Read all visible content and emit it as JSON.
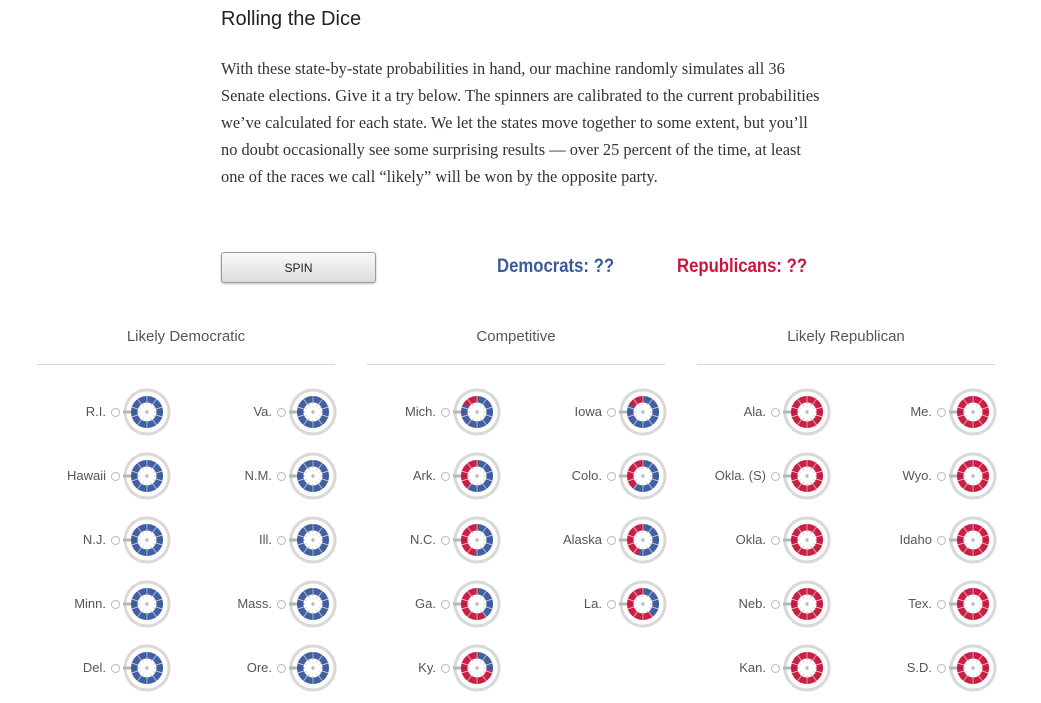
{
  "article": {
    "title": "Rolling the Dice",
    "intro": "With these state-by-state probabilities in hand, our machine randomly simulates all 36 Senate elections. Give it a try below. The spinners are calibrated to the current probabilities we’ve calculated for each state. We let the states move together to some extent, but you’ll no doubt occasionally see some surprising results — over 25 percent of the time, at least one of the races we call “likely” will be won by the opposite party."
  },
  "controls": {
    "spin_label": "SPIN",
    "dem_label": "Democrats: ??",
    "rep_label": "Republicans: ??"
  },
  "colors": {
    "democratic": "#3b5a9d",
    "republican": "#c8173f",
    "dial_ring": "#d9d9d9"
  },
  "groups": [
    {
      "heading": "Likely Democratic",
      "states": [
        {
          "name": "R.I.",
          "dem_share": 1.0
        },
        {
          "name": "Va.",
          "dem_share": 1.0
        },
        {
          "name": "Hawaii",
          "dem_share": 1.0
        },
        {
          "name": "N.M.",
          "dem_share": 1.0
        },
        {
          "name": "N.J.",
          "dem_share": 1.0
        },
        {
          "name": "Ill.",
          "dem_share": 1.0
        },
        {
          "name": "Minn.",
          "dem_share": 0.99
        },
        {
          "name": "Mass.",
          "dem_share": 1.0
        },
        {
          "name": "Del.",
          "dem_share": 0.99
        },
        {
          "name": "Ore.",
          "dem_share": 0.99
        }
      ]
    },
    {
      "heading": "Competitive",
      "states": [
        {
          "name": "Mich.",
          "dem_share": 0.82
        },
        {
          "name": "Iowa",
          "dem_share": 0.84
        },
        {
          "name": "Ark.",
          "dem_share": 0.6
        },
        {
          "name": "Colo.",
          "dem_share": 0.62
        },
        {
          "name": "N.C.",
          "dem_share": 0.54
        },
        {
          "name": "Alaska",
          "dem_share": 0.55
        },
        {
          "name": "Ga.",
          "dem_share": 0.42
        },
        {
          "name": "La.",
          "dem_share": 0.4
        },
        {
          "name": "Ky.",
          "dem_share": 0.27
        }
      ]
    },
    {
      "heading": "Likely Republican",
      "states": [
        {
          "name": "Ala.",
          "dem_share": 0.0
        },
        {
          "name": "Me.",
          "dem_share": 0.0
        },
        {
          "name": "Okla. (S)",
          "dem_share": 0.0
        },
        {
          "name": "Wyo.",
          "dem_share": 0.0
        },
        {
          "name": "Okla.",
          "dem_share": 0.0
        },
        {
          "name": "Idaho",
          "dem_share": 0.0
        },
        {
          "name": "Neb.",
          "dem_share": 0.0
        },
        {
          "name": "Tex.",
          "dem_share": 0.0
        },
        {
          "name": "Kan.",
          "dem_share": 0.0
        },
        {
          "name": "S.D.",
          "dem_share": 0.0
        }
      ]
    }
  ]
}
